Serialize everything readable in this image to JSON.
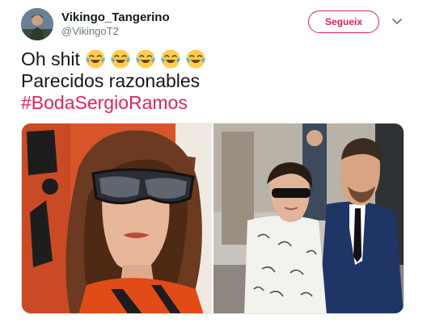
{
  "tweet": {
    "user": {
      "display_name": "Vikingo_Tangerino",
      "handle": "@VikingoT2",
      "avatar_icon": "user-avatar"
    },
    "follow_button": "Segueix",
    "menu_icon": "chevron-down-icon",
    "text_lines": [
      "Oh shit",
      "Parecidos razonables"
    ],
    "emoji": [
      "face-with-tears-of-joy",
      "face-with-tears-of-joy",
      "face-with-tears-of-joy",
      "face-with-tears-of-joy",
      "face-with-tears-of-joy"
    ],
    "hashtag": "#BodaSergioRamos",
    "media": [
      {
        "name": "photo-woman-orange-jacket-goggles"
      },
      {
        "name": "photo-couple-at-wedding"
      }
    ]
  },
  "colors": {
    "accent": "#e0245e",
    "text": "#14171a",
    "secondary_text": "#657786",
    "border": "#e1e8ed"
  }
}
